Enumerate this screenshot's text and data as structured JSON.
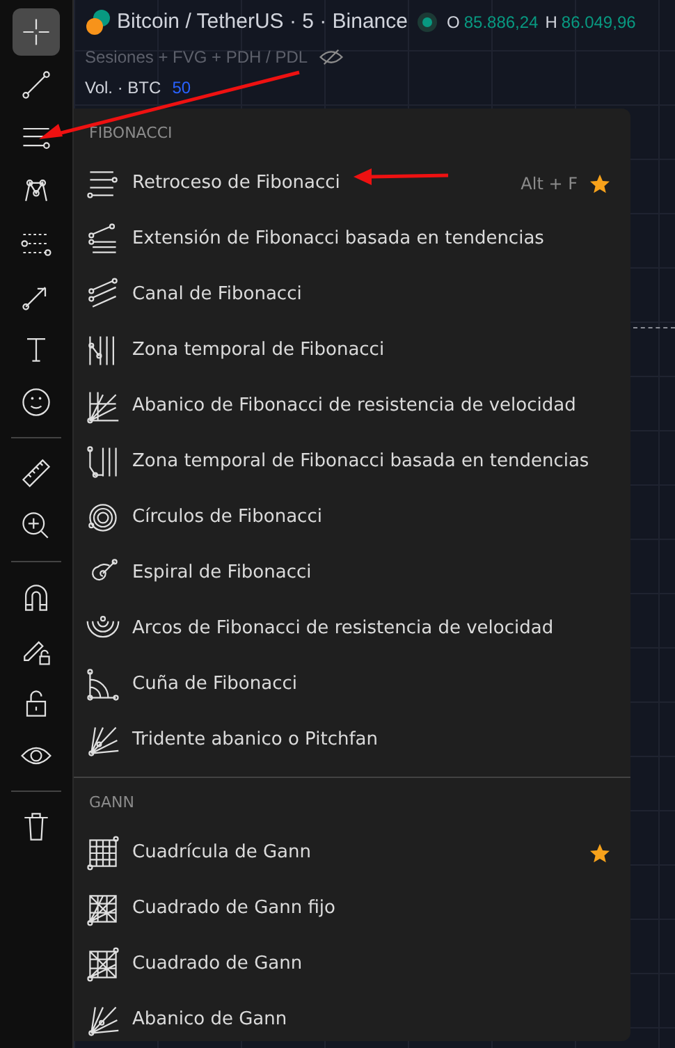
{
  "tools": [
    {
      "selected": true
    },
    {
      "selected": false
    },
    {
      "selected": false
    },
    {
      "selected": false
    },
    {
      "selected": false
    },
    {
      "selected": false
    },
    {
      "selected": false
    },
    {
      "selected": false
    },
    {
      "selected": false
    },
    {
      "selected": false
    },
    {
      "selected": false
    },
    {
      "selected": false
    },
    {
      "selected": false
    },
    {
      "selected": false
    },
    {
      "selected": false
    }
  ],
  "header": {
    "symbol": "Bitcoin / TetherUS · 5 · Binance",
    "ohlc": [
      {
        "label": "O",
        "value": "85.886,24"
      },
      {
        "label": "H",
        "value": "86.049,96"
      }
    ],
    "indicator": "Sesiones + FVG + PDH / PDL",
    "volume_label": "Vol. · BTC",
    "volume_value": "50"
  },
  "menu": {
    "sections": [
      {
        "title": "FIBONACCI",
        "items": [
          {
            "label": "Retroceso de Fibonacci",
            "shortcut": "Alt + F",
            "favorite": true
          },
          {
            "label": "Extensión de Fibonacci basada en tendencias",
            "favorite": false
          },
          {
            "label": "Canal de Fibonacci",
            "favorite": false
          },
          {
            "label": "Zona temporal de Fibonacci",
            "favorite": false
          },
          {
            "label": "Abanico de Fibonacci de resistencia de velocidad",
            "favorite": false
          },
          {
            "label": "Zona temporal de Fibonacci basada en tendencias",
            "favorite": false
          },
          {
            "label": "Círculos de Fibonacci",
            "favorite": false
          },
          {
            "label": "Espiral de Fibonacci",
            "favorite": false
          },
          {
            "label": "Arcos de Fibonacci de resistencia de velocidad",
            "favorite": false
          },
          {
            "label": "Cuña de Fibonacci",
            "favorite": false
          },
          {
            "label": "Tridente abanico o Pitchfan",
            "favorite": false
          }
        ]
      },
      {
        "title": "GANN",
        "items": [
          {
            "label": "Cuadrícula de Gann",
            "favorite": true
          },
          {
            "label": "Cuadrado de Gann fijo",
            "favorite": false
          },
          {
            "label": "Cuadrado de Gann",
            "favorite": false
          },
          {
            "label": "Abanico de Gann",
            "favorite": false
          }
        ]
      }
    ]
  }
}
